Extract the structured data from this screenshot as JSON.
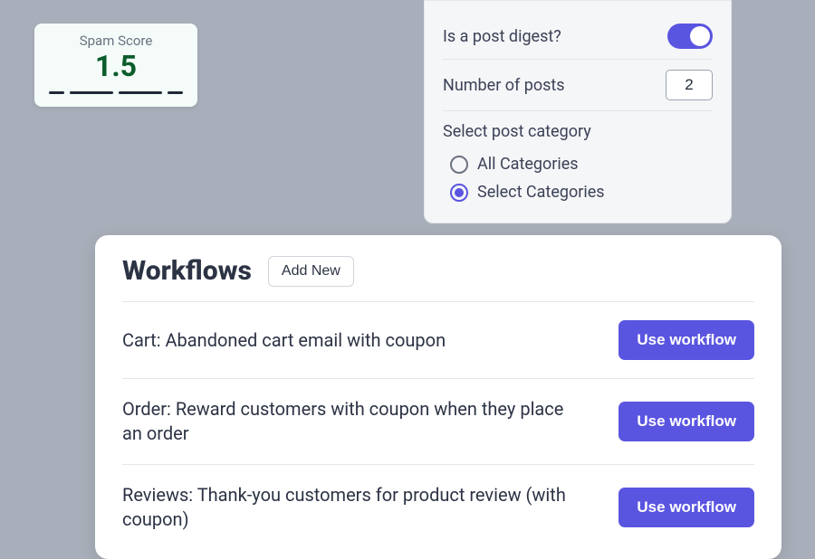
{
  "spam": {
    "label": "Spam Score",
    "value": "1.5"
  },
  "settings": {
    "digest_label": "Is a post digest?",
    "digest_on": true,
    "num_posts_label": "Number of posts",
    "num_posts_value": "2",
    "category_title": "Select post category",
    "radio_all": "All Categories",
    "radio_select": "Select Categories",
    "selected_radio": "select"
  },
  "workflows": {
    "title": "Workflows",
    "add_new_label": "Add New",
    "use_label": "Use workflow",
    "items": [
      {
        "desc": "Cart: Abandoned cart email with coupon"
      },
      {
        "desc": "Order: Reward customers with coupon when they place an order"
      },
      {
        "desc": "Reviews: Thank-you customers for product review (with coupon)"
      }
    ]
  }
}
